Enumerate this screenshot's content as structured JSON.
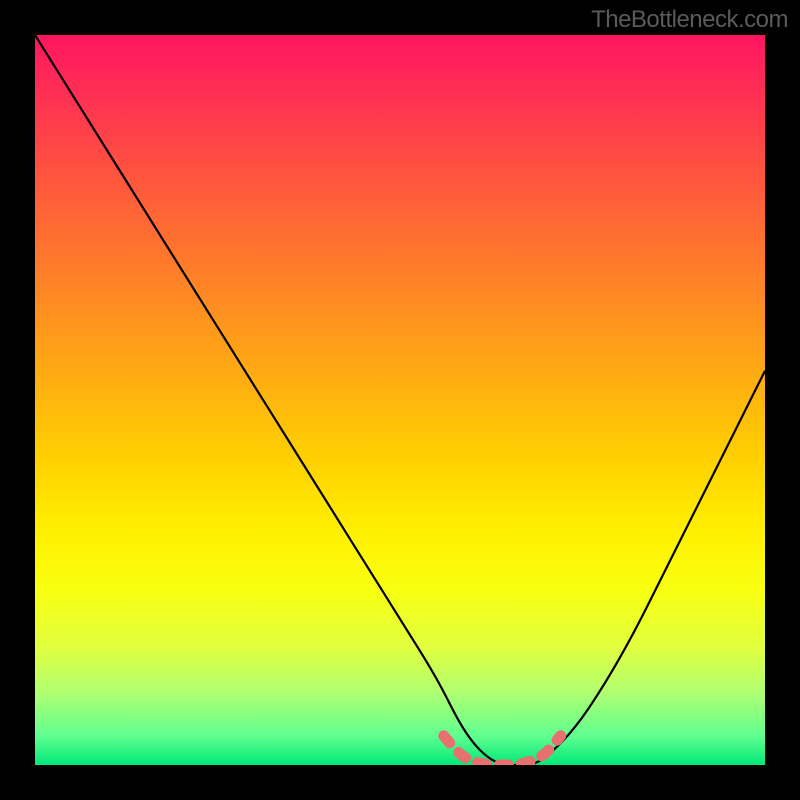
{
  "watermark": "TheBottleneck.com",
  "chart_data": {
    "type": "line",
    "title": "",
    "xlabel": "",
    "ylabel": "",
    "xlim": [
      0,
      100
    ],
    "ylim": [
      0,
      100
    ],
    "series": [
      {
        "name": "bottleneck-curve",
        "color": "#000000",
        "x": [
          0,
          5,
          10,
          15,
          20,
          25,
          30,
          35,
          40,
          45,
          50,
          55,
          58,
          60,
          62,
          64,
          66,
          68,
          70,
          74,
          78,
          82,
          86,
          90,
          94,
          98,
          100
        ],
        "y": [
          100,
          92,
          84,
          76,
          68,
          60,
          52,
          44,
          36,
          28,
          20,
          12,
          6,
          3,
          1,
          0,
          0,
          0,
          1,
          5,
          11,
          18,
          26,
          34,
          42,
          50,
          54
        ]
      },
      {
        "name": "optimal-zone-marker",
        "color": "#e8706f",
        "x": [
          56,
          58,
          60,
          62,
          64,
          66,
          68,
          70,
          72
        ],
        "y": [
          4,
          1.5,
          0.5,
          0,
          0,
          0,
          0.5,
          1.5,
          4
        ]
      }
    ],
    "annotations": []
  }
}
